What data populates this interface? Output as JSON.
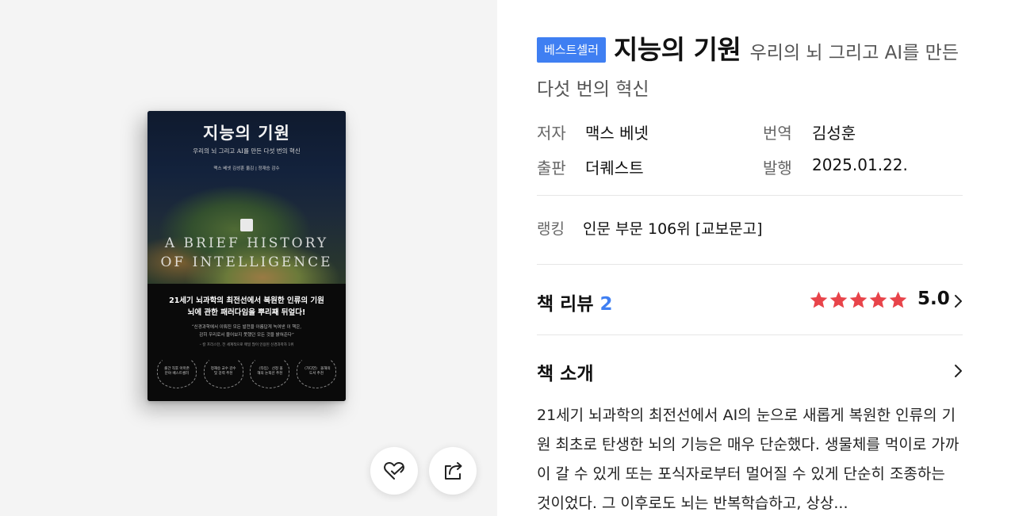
{
  "cover": {
    "title": "지능의 기원",
    "subtitle": "우리의 뇌 그리고 AI를 만든 다섯 번의 혁신",
    "authors": "맥스 베넷  김성훈 옮김 | 정재승 감수",
    "english_title_line1": "A BRIEF HISTORY",
    "english_title_line2": "OF INTELLIGENCE",
    "headline_line1": "21세기 뇌과학의 최전선에서 복원한 인류의 기원",
    "headline_line2": "뇌에 관한 패러다임을 뿌리째 뒤엎다!",
    "quote_line1": "“신경과학에서 이뤄진 모든 발전을 아름답게 녹여낸 이 책은,",
    "quote_line2": "감히 우리로서 물어보지 못했던 모든 것을 밝혀준다”",
    "quote_author": "– 칼 프리스턴, 전 세계적으로 매일 많이 인용된 신경과학자 1위",
    "laurels": [
      "출간 직후 아마존 분야 베스트셀러",
      "정재승 교수 감수 및 강력 추천",
      "〈타임〉 선정 올해의 논픽션 추천",
      "〈가디언〉 올해의 도서 추천"
    ]
  },
  "actions": {
    "wishlist_icon": "heart-check-icon",
    "share_icon": "share-icon"
  },
  "book": {
    "badge": "베스트셀러",
    "title": "지능의 기원",
    "subtitle": "우리의 뇌 그리고 AI를 만든 다섯 번의 혁신",
    "author_label": "저자",
    "author": "맥스 베넷",
    "translator_label": "번역",
    "translator": "김성훈",
    "publisher_label": "출판",
    "publisher": "더퀘스트",
    "date_label": "발행",
    "date": "2025.01.22.",
    "ranking_label": "랭킹",
    "ranking": "인문 부문 106위 [교보문고]"
  },
  "review": {
    "title": "책 리뷰",
    "count": "2",
    "rating": "5.0",
    "stars": 5,
    "star_color": "#e8444a"
  },
  "intro": {
    "title": "책 소개",
    "text": "21세기 뇌과학의 최전선에서 AI의 눈으로 새롭게 복원한 인류의 기원 최초로 탄생한 뇌의 기능은 매우 단순했다. 생물체를 먹이로 가까이 갈 수 있게 또는 포식자로부터 멀어질 수 있게 단순히 조종하는 것이었다. 그 이후로도 뇌는 반복학습하고, 상상..."
  },
  "colors": {
    "accent": "#3f7ff2",
    "left_panel_bg": "#f4f4f4"
  }
}
